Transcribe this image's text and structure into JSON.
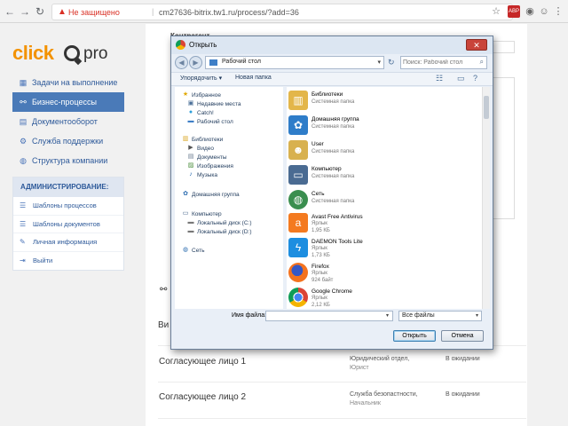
{
  "browser": {
    "security_label": "Не защищено",
    "url": "cm27636-bitrix.tw1.ru/process/?add=36",
    "separator": "|"
  },
  "logo": {
    "primary": "click",
    "secondary": "pro"
  },
  "sidebar": {
    "items": [
      {
        "label": "Задачи на выполнение",
        "icon": "calendar-icon",
        "active": false
      },
      {
        "label": "Бизнес-процессы",
        "icon": "hierarchy-icon",
        "active": true
      },
      {
        "label": "Документооборот",
        "icon": "document-icon",
        "active": false
      },
      {
        "label": "Служба поддержки",
        "icon": "gears-icon",
        "active": false
      },
      {
        "label": "Структура компании",
        "icon": "globe-icon",
        "active": false
      }
    ],
    "admin": {
      "title": "АДМИНИСТРИРОВАНИЕ:",
      "items": [
        {
          "label": "Шаблоны процессов",
          "icon": "list-icon"
        },
        {
          "label": "Шаблоны документов",
          "icon": "list-icon"
        },
        {
          "label": "Личная информация",
          "icon": "edit-icon"
        },
        {
          "label": "Выйти",
          "icon": "logout-icon"
        }
      ]
    }
  },
  "main": {
    "contractor_label": "Контрагент",
    "truncated_label": "Ви",
    "signers": [
      {
        "name": "Согласующее лицо 1",
        "dept": "Юридический отдел,",
        "position": "Юрист",
        "status": "В ожидании"
      },
      {
        "name": "Согласующее лицо 2",
        "dept": "Служба безопастности,",
        "position": "Начальник",
        "status": "В ожидании"
      }
    ]
  },
  "dialog": {
    "title": "Открыть",
    "close_label": "✕",
    "address": "Рабочий стол",
    "search_placeholder": "Поиск: Рабочий стол",
    "toolbar": {
      "organize": "Упорядочить ▾",
      "new_folder": "Новая папка"
    },
    "nav": {
      "favorites": "Избранное",
      "recent": "Недавние места",
      "catch": "Catch!",
      "desktop": "Рабочий стол",
      "libraries": "Библиотеки",
      "video": "Видео",
      "documents": "Документы",
      "images": "Изображения",
      "music": "Музыка",
      "homegroup": "Домашняя группа",
      "computer": "Компьютер",
      "disk_c": "Локальный диск (C:)",
      "disk_d": "Локальный диск (D:)",
      "network": "Сеть"
    },
    "files": [
      {
        "name": "Библиотеки",
        "sub1": "Системная папка",
        "sub2": "",
        "icon": "libraries-icon"
      },
      {
        "name": "Домашняя группа",
        "sub1": "Системная папка",
        "sub2": "",
        "icon": "homegroup-icon"
      },
      {
        "name": "User",
        "sub1": "Системная папка",
        "sub2": "",
        "icon": "user-folder-icon"
      },
      {
        "name": "Компьютер",
        "sub1": "Системная папка",
        "sub2": "",
        "icon": "computer-icon"
      },
      {
        "name": "Сеть",
        "sub1": "Системная папка",
        "sub2": "",
        "icon": "network-icon"
      },
      {
        "name": "Avast Free Antivirus",
        "sub1": "Ярлык",
        "sub2": "1,95 КБ",
        "icon": "avast-icon"
      },
      {
        "name": "DAEMON Tools Lite",
        "sub1": "Ярлык",
        "sub2": "1,73 КБ",
        "icon": "daemon-tools-icon"
      },
      {
        "name": "Firefox",
        "sub1": "Ярлык",
        "sub2": "924 байт",
        "icon": "firefox-icon"
      },
      {
        "name": "Google Chrome",
        "sub1": "Ярлык",
        "sub2": "2,12 КБ",
        "icon": "chrome-icon"
      }
    ],
    "filename_label": "Имя файла:",
    "filename_value": "",
    "filetype": "Все файлы",
    "open_label": "Открыть",
    "cancel_label": "Отмена"
  }
}
